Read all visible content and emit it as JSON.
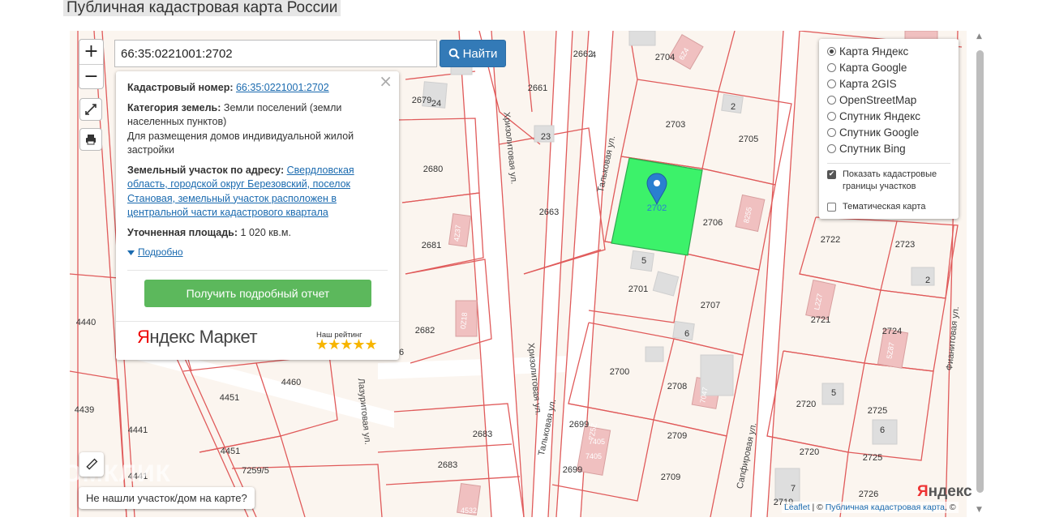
{
  "page": {
    "title": "Публичная кадастровая карта России"
  },
  "search": {
    "value": "66:35:0221001:2702",
    "button_label": "Найти"
  },
  "zoom": {
    "in_label": "+",
    "out_label": "−"
  },
  "popup": {
    "cadastral_label": "Кадастровый номер:",
    "cadastral_number": "66:35:0221001:2702",
    "category_label": "Категория земель:",
    "category_value": "Земли поселений (земли населенных пунктов)",
    "purpose": "Для размещения домов индивидуальной жилой застройки",
    "address_label": "Земельный участок по адресу:",
    "address_value": "Свердловская область, городской округ Березовский, поселок Становая, земельный участок расположен в центральной части кадастрового квартала",
    "area_label": "Уточненная площадь:",
    "area_value": "1 020 кв.м.",
    "more_label": "Подробно",
    "report_button": "Получить подробный отчет",
    "ad_brand_first": "Я",
    "ad_brand_rest": "ндекс Маркет",
    "ad_rating_label": "Наш рейтинг",
    "ad_stars": "★★★★★",
    "close": "×"
  },
  "layers": {
    "options": [
      "Карта Яндекс",
      "Карта Google",
      "Карта 2GIS",
      "OpenStreetMap",
      "Спутник Яндекс",
      "Спутник Google",
      "Спутник Bing"
    ],
    "selected": "Карта Яндекс",
    "checkbox_boundaries": "Показать кадастровые границы участков",
    "checkbox_thematic": "Тематическая карта",
    "boundaries_checked": true,
    "thematic_checked": false
  },
  "map_labels": {
    "parcels": [
      "2662",
      "2661",
      "2679",
      "2680",
      "2681",
      "2682",
      "2663",
      "2704",
      "2703",
      "2705",
      "2702",
      "2706",
      "2701",
      "2707",
      "2700",
      "2708",
      "2699",
      "2709",
      "2722",
      "2723",
      "2721",
      "2724",
      "2720",
      "2725",
      "2726",
      "2719",
      "4440",
      "4439",
      "4441",
      "4451",
      "4460",
      "2683",
      "7259/5",
      "2699"
    ],
    "house_numbers": [
      "4",
      "24",
      "23",
      "2",
      "5",
      "6",
      "2",
      "5",
      "6",
      "7"
    ],
    "streets": [
      "Хризолитовая ул.",
      "Тальковая ул.",
      "Хризолитовая ул.",
      "Тальковая ул.",
      "Сапфировая ул.",
      "Фианитовая ул.",
      "Лазуритовая ул."
    ],
    "building_numbers": [
      "6Z4",
      "4Z37",
      "0Z18",
      "8255",
      "L2Z7",
      "5Z87",
      "7047",
      "7Z5Z",
      "7405",
      "7405",
      "4532"
    ]
  },
  "notfound": "Не нашли участок/дом на карте?",
  "watermark": "ДОМКЛИК",
  "yandex_logo_first": "Я",
  "yandex_logo_rest": "ндекс",
  "attribution": {
    "leaflet": "Leaflet",
    "separator": " | © ",
    "pkk": "Публичная кадастровая карта",
    "tail": ", ©"
  },
  "colors": {
    "parcel_line": "#e05a5a",
    "selected_parcel": "#3cf26a",
    "marker": "#2a7fd0",
    "map_bg": "#fbf5ef",
    "button_blue": "#337ab7",
    "button_green": "#5cb85c"
  }
}
